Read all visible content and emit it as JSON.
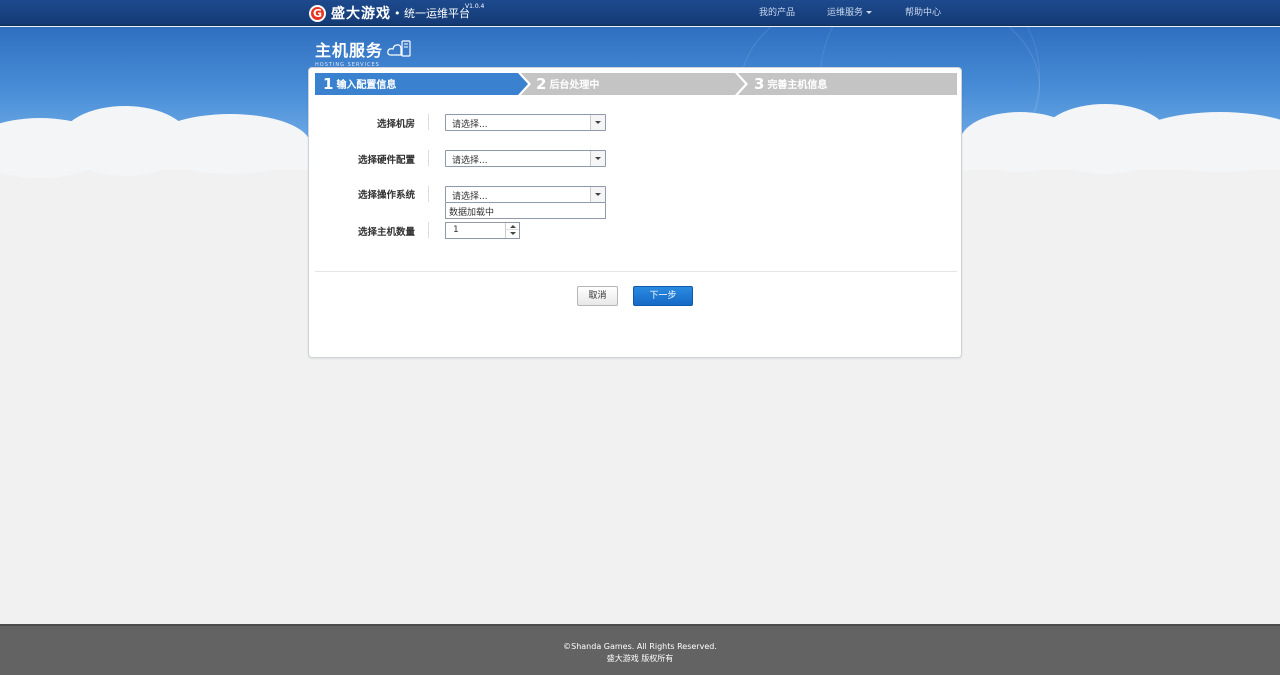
{
  "header": {
    "logo_mark": "G",
    "brand": "盛大游戏",
    "platform": "• 统一运维平台",
    "version": "V1.0.4",
    "nav": [
      {
        "label": "我的产品"
      },
      {
        "label": "运维服务"
      },
      {
        "label": "帮助中心"
      }
    ]
  },
  "banner": {
    "title": "主机服务",
    "subtitle": "HOSTING SERVICES"
  },
  "steps": [
    {
      "num": "1",
      "label": "输入配置信息",
      "state": "active"
    },
    {
      "num": "2",
      "label": "后台处理中",
      "state": "inactive"
    },
    {
      "num": "3",
      "label": "完善主机信息",
      "state": "inactive"
    }
  ],
  "form": {
    "datacenter": {
      "label": "选择机房",
      "value": "请选择..."
    },
    "hardware": {
      "label": "选择硬件配置",
      "value": "请选择..."
    },
    "os": {
      "label": "选择操作系统",
      "value": "请选择...",
      "dropdown_text": "数据加载中"
    },
    "quantity": {
      "label": "选择主机数量",
      "value": "1"
    }
  },
  "actions": {
    "cancel": "取消",
    "next": "下一步"
  },
  "footer": {
    "copyright": "©Shanda Games. All Rights Reserved.",
    "rights_cn": "盛大游戏 版权所有"
  },
  "colors": {
    "topbar": "#1d4a8e",
    "step_active": "#3a82cf",
    "step_inactive": "#c4c4c4",
    "primary_button": "#1a78d6",
    "footer": "#636363"
  }
}
